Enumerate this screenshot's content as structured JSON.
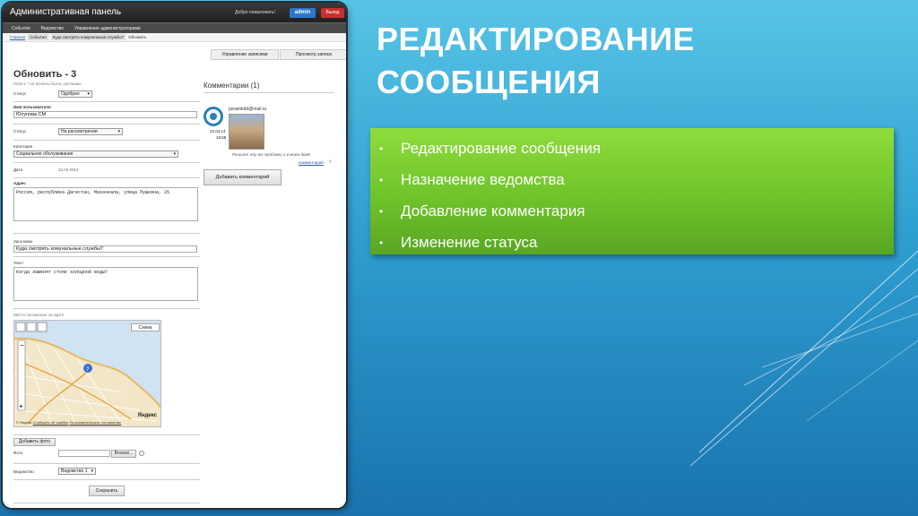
{
  "slide": {
    "title_line1": "РЕДАКТИРОВАНИЕ",
    "title_line2": "СООБЩЕНИЯ",
    "bullets": [
      "Редактирование сообщения",
      "Назначение ведомства",
      "Добавление комментария",
      "Изменение статуса"
    ]
  },
  "app": {
    "title": "Административная панель",
    "welcome": "Добро пожаловать!",
    "user": "admin",
    "exit": "Выход",
    "nav": [
      "События",
      "Ведомство",
      "Управление администраторами"
    ],
    "breadcrumbs": [
      "Главная",
      "События",
      "Куда смотрять комунальные службы?",
      "Обновить"
    ],
    "buttons": {
      "manage": "Управление записями",
      "view": "Просмотр записи"
    },
    "form": {
      "heading": "Обновить - 3",
      "note": "Поля с * не должны быть пустыми.",
      "status_label": "Статус",
      "status_value": "Одобрен",
      "username_label": "Имя пользователя",
      "username_value": "Юсупова СМ",
      "status2_label": "Статус",
      "status2_value": "На рассмотрении",
      "category_label": "Категория",
      "category_value": "Социальное обслуживание",
      "date_label": "Дата",
      "date_value": "22.04.2013",
      "address_label": "Адрес",
      "address_value": "Россия, республика Дагестан, Махачкала, улица Пушкина, 25",
      "subject_label": "Заголовок",
      "subject_value": "Куда смотрять комунальные службы?",
      "text_label": "Текст",
      "text_value": "Когда заменят стояк холодной воды?",
      "map_label": "Место положение на карте",
      "map_type": "Схема",
      "map_brand": "Яндекс",
      "map_footer_a": "© Яндекс",
      "map_footer_b": "Сообщить об ошибке",
      "map_footer_c": "Пользовательское соглашение",
      "add_photo": "Добавить фото",
      "photo_label": "Фото",
      "browse": "Browse...",
      "dept_label": "Ведомство",
      "dept_value": "Ведомство 1",
      "save": "Сохранить"
    },
    "comments": {
      "heading": "Комментарии (1)",
      "email": "poramkdd@mail.ru",
      "date": "22.04.13",
      "time": "19:58",
      "text": "Решите эту же проблему и в моем доме",
      "reply": "комментарий",
      "add": "Добавить комментарий"
    }
  }
}
